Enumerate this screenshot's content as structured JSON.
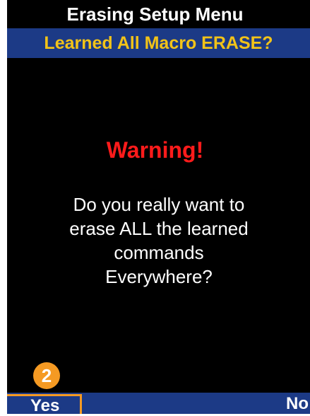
{
  "header": {
    "title": "Erasing Setup Menu",
    "subtitle": "Learned All Macro ERASE?"
  },
  "dialog": {
    "warning": "Warning!",
    "message_lines": [
      "Do you really want to",
      "erase ALL the learned",
      "commands",
      "Everywhere?"
    ]
  },
  "softkeys": {
    "left": "Yes",
    "right": "No"
  },
  "callout": {
    "number": "2"
  },
  "colors": {
    "screen_bg": "#000000",
    "bar_blue": "#1c3a86",
    "subtitle_text": "#f2c318",
    "warning_red": "#ff1b1b",
    "callout_orange": "#f59a23"
  }
}
